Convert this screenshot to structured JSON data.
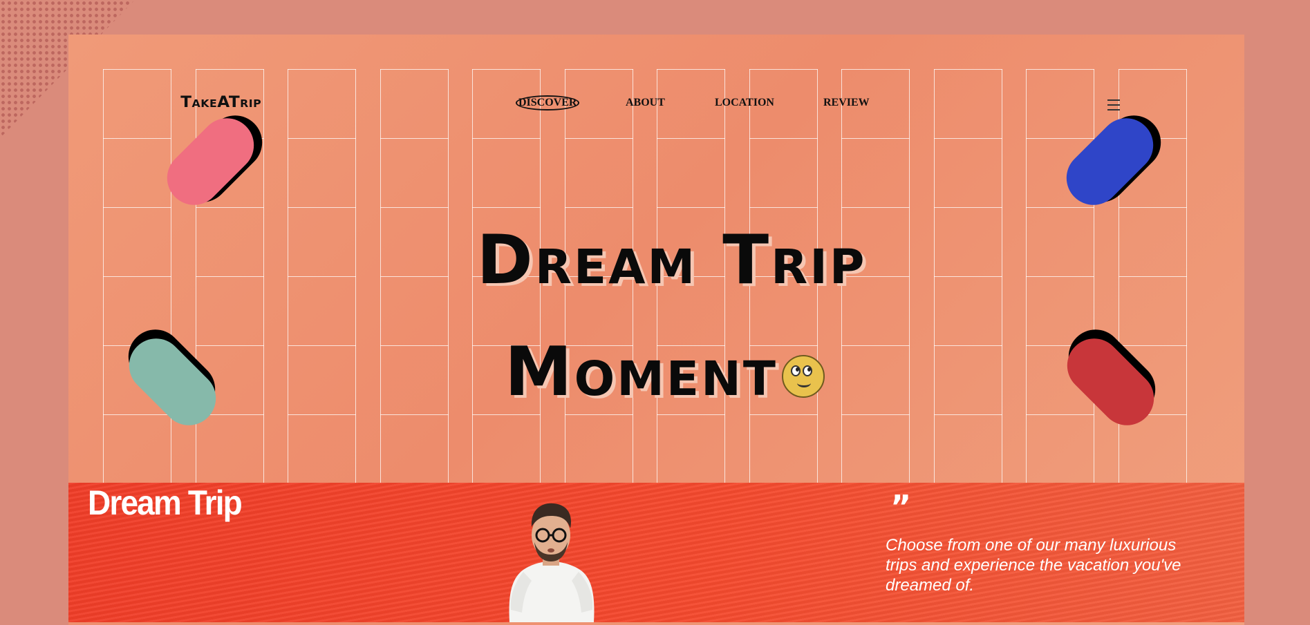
{
  "header": {
    "logo": "TakeATrip",
    "nav": [
      {
        "label": "DISCOVER",
        "active": true
      },
      {
        "label": "ABOUT",
        "active": false
      },
      {
        "label": "LOCATION",
        "active": false
      },
      {
        "label": "REVIEW",
        "active": false
      }
    ],
    "menu_icon": "hamburger-icon"
  },
  "hero": {
    "title_line1": "Dream Trip",
    "title_line2": "Moment",
    "emoji_icon": "rolling-eyes-emoji-icon"
  },
  "decor": {
    "pills": [
      {
        "name": "pink-pill",
        "color": "#f06e80"
      },
      {
        "name": "teal-pill",
        "color": "#86b9aa"
      },
      {
        "name": "blue-pill",
        "color": "#2f45c8"
      },
      {
        "name": "red-pill",
        "color": "#c8363a"
      }
    ]
  },
  "banner": {
    "title": "Dream Trip",
    "quote_mark": "”",
    "quote": "Choose from one of our many luxurious trips and experience the vacation you've dreamed of.",
    "image_icon": "man-with-glasses-photo"
  }
}
